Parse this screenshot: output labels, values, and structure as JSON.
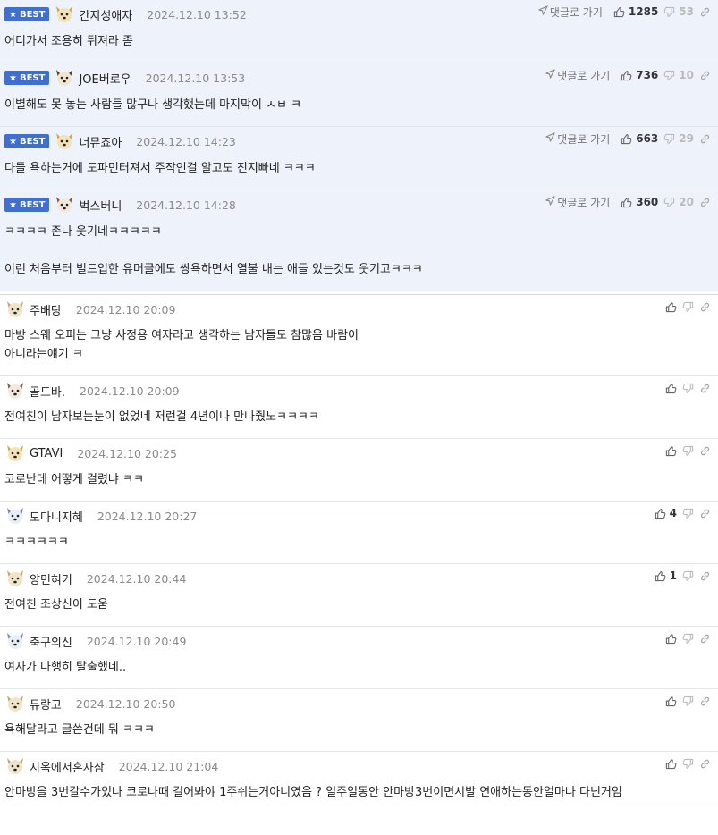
{
  "labels": {
    "best": "BEST",
    "goto": "댓글로 가기"
  },
  "colors": {
    "best_badge": "#3f6fd1",
    "best_row_bg": "#eef3fb",
    "muted": "#8a8a8a"
  },
  "best_comments": [
    {
      "nick": "간지성애자",
      "date": "2024.12.10 13:52",
      "up": "1285",
      "down": "53",
      "avatar": "dog-face-tan-icon",
      "text": "어디가서 조용히 뒤져라 좀"
    },
    {
      "nick": "JOE버로우",
      "date": "2024.12.10 13:53",
      "up": "736",
      "down": "10",
      "avatar": "dog-face-dark-icon",
      "text": "이별해도 못 놓는 사람들 많구나 생각했는데 마지막이 ㅅㅂ ㅋ"
    },
    {
      "nick": "너뮤죠아",
      "date": "2024.12.10 14:23",
      "up": "663",
      "down": "29",
      "avatar": "dog-face-tan-icon",
      "text": "다들 욕하는거에 도파민터져서 주작인걸 알고도 진지빠네 ㅋㅋㅋ"
    },
    {
      "nick": "벅스버니",
      "date": "2024.12.10 14:28",
      "up": "360",
      "down": "20",
      "avatar": "dog-face-brown-icon",
      "text": "ㅋㅋㅋㅋ 존나 웃기네ㅋㅋㅋㅋㅋ\n\n이런 처음부터 빌드업한 유머글에도 쌍욕하면서 열불 내는 애들 있는것도 웃기고ㅋㅋㅋ"
    }
  ],
  "comments": [
    {
      "nick": "주배당",
      "date": "2024.12.10 20:09",
      "up": "",
      "avatar": "dog-face-pale-icon",
      "text": "마방 스웨 오피는 그냥 사정용 여자라고 생각하는 남자들도 참많음 바람이\n아니라는얘기 ㅋ"
    },
    {
      "nick": "골드바.",
      "date": "2024.12.10 20:09",
      "up": "",
      "avatar": "dog-face-brown-icon",
      "text": "전여친이 남자보는눈이 없었네 저런걸 4년이나 만나줬노ㅋㅋㅋㅋ"
    },
    {
      "nick": "GTAVI",
      "date": "2024.12.10 20:25",
      "up": "",
      "avatar": "dog-face-tan-icon",
      "text": "코로난데 어떻게 걸렸냐 ㅋㅋ"
    },
    {
      "nick": "모다니지혜",
      "date": "2024.12.10 20:27",
      "up": "4",
      "avatar": "dog-face-blue-icon",
      "text": "ㅋㅋㅋㅋㅋㅋ"
    },
    {
      "nick": "양민혀기",
      "date": "2024.12.10 20:44",
      "up": "1",
      "avatar": "dog-face-pale-icon",
      "text": "전여친 조상신이 도움"
    },
    {
      "nick": "축구의신",
      "date": "2024.12.10 20:49",
      "up": "",
      "avatar": "dog-face-blue-icon",
      "text": "여자가 다행히 탈출했네.."
    },
    {
      "nick": "듀랑고",
      "date": "2024.12.10 20:50",
      "up": "",
      "avatar": "dog-face-pale-icon",
      "text": "욕해달라고 글쓴건데 뭐 ㅋㅋㅋ"
    },
    {
      "nick": "지옥에서혼자삼",
      "date": "2024.12.10 21:04",
      "up": "",
      "avatar": "dog-face-pale-icon",
      "text": "안마방을 3번갈수가있나 코로나때 길어봐야 1주쉬는거아니였음 ? 일주일동안 안마방3번이면시발 연애하는동안얼마나 다닌거임"
    }
  ]
}
